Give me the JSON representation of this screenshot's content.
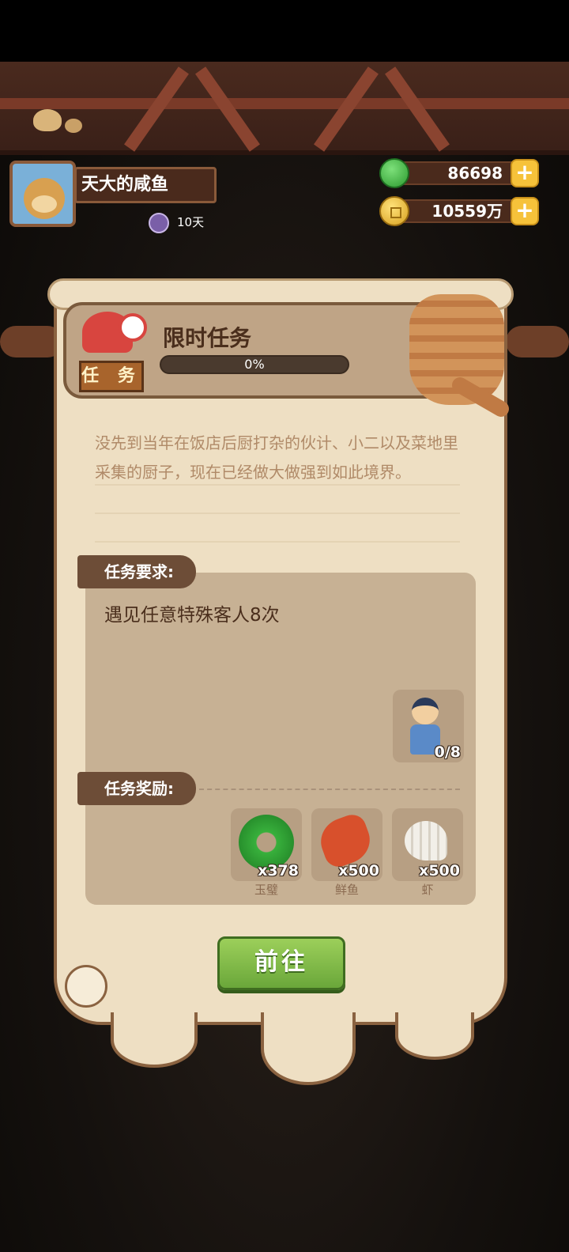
{
  "header": {
    "player_name": "天大的咸鱼",
    "days": "10天",
    "jade": "86698",
    "coins": "10559万",
    "plus_symbol": "+"
  },
  "task": {
    "tag": "任 务",
    "title": "限时任务",
    "progress_label": "0%",
    "progress_fraction": 0,
    "description": "没先到当年在饭店后厨打杂的伙计、小二以及菜地里采集的厨子，现在已经做大做强到如此境界。",
    "requirement_header": "任务要求:",
    "requirement_text": "遇见任意特殊客人8次",
    "requirement_progress": "0/8",
    "reward_header": "任务奖励:",
    "rewards": [
      {
        "name": "玉璧",
        "count": "x378",
        "icon": "jade-disc-icon"
      },
      {
        "name": "鲜鱼",
        "count": "x500",
        "icon": "fish-icon"
      },
      {
        "name": "虾",
        "count": "x500",
        "icon": "shrimp-icon"
      }
    ],
    "go_button": "前往"
  },
  "colors": {
    "accent_green": "#7fc04a",
    "parchment": "#eedfc3",
    "wood": "#6d4d37"
  }
}
